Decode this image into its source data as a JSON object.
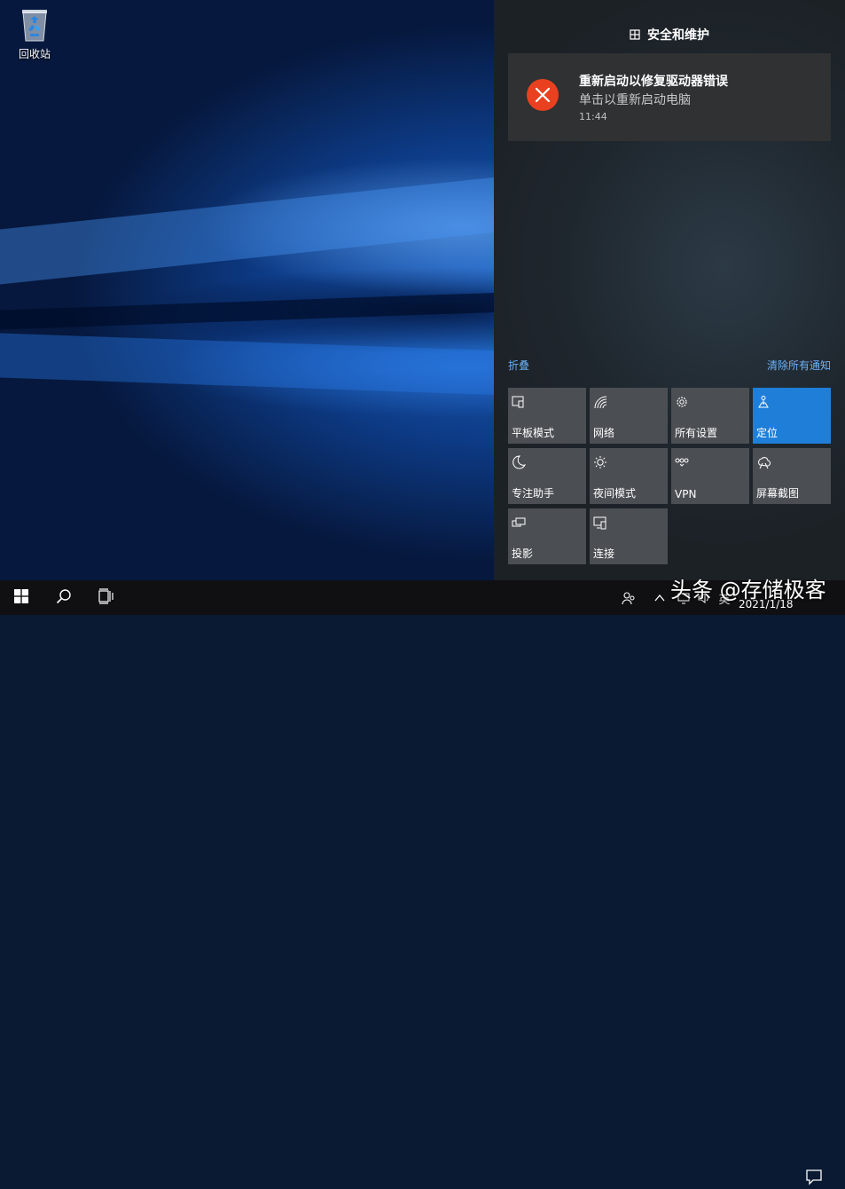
{
  "desktop": {
    "icons": [
      {
        "label": "回收站",
        "icon": "recycle-bin-icon"
      }
    ]
  },
  "action_center": {
    "header_title": "安全和维护",
    "notification": {
      "title": "重新启动以修复驱动器错误",
      "body": "单击以重新启动电脑",
      "time": "11:44",
      "icon": "error-x-icon",
      "icon_color": "#e9401f"
    },
    "collapse_label": "折叠",
    "clear_all_label": "清除所有通知",
    "link_color": "#6bb0f5",
    "tiles": [
      {
        "label": "平板模式",
        "icon": "tablet-mode-icon",
        "active": false
      },
      {
        "label": "网络",
        "icon": "network-icon",
        "active": false
      },
      {
        "label": "所有设置",
        "icon": "settings-gear-icon",
        "active": false
      },
      {
        "label": "定位",
        "icon": "location-icon",
        "active": true
      },
      {
        "label": "专注助手",
        "icon": "moon-icon",
        "active": false
      },
      {
        "label": "夜间模式",
        "icon": "night-light-icon",
        "active": false
      },
      {
        "label": "VPN",
        "icon": "vpn-icon",
        "active": false
      },
      {
        "label": "屏幕截图",
        "icon": "screen-snip-icon",
        "active": false
      },
      {
        "label": "投影",
        "icon": "project-icon",
        "active": false
      },
      {
        "label": "连接",
        "icon": "connect-icon",
        "active": false
      }
    ],
    "accent_color": "#1f7fd8"
  },
  "taskbar": {
    "start": "windows-logo-icon",
    "search": "search-icon",
    "task_view": "task-view-icon",
    "tray": {
      "people": "people-icon",
      "chevron": "chevron-up-icon",
      "ime_label": "英",
      "date": "2021/1/18",
      "notifications": "notification-center-icon"
    }
  },
  "watermark": "头条 @存储极客"
}
